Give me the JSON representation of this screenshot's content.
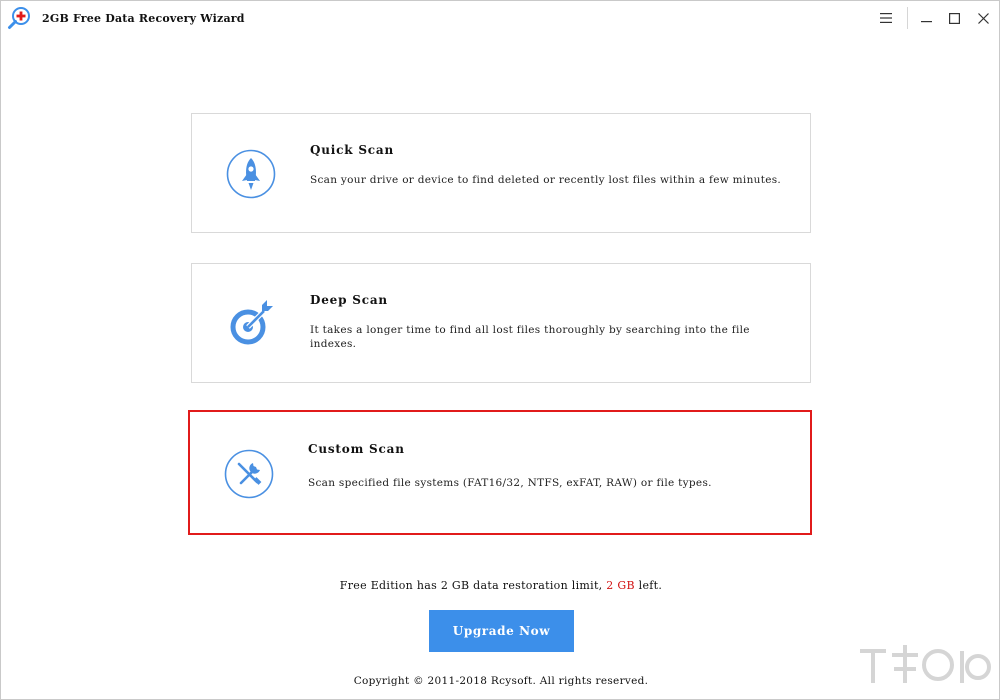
{
  "window": {
    "title": "2GB Free Data Recovery Wizard"
  },
  "titlebar_controls": [
    "menu-icon",
    "minimize-icon",
    "maximize-icon",
    "close-icon"
  ],
  "scan_options": [
    {
      "title": "Quick Scan",
      "description": "Scan your drive or device to find deleted or recently lost files within a few minutes.",
      "icon": "rocket-icon",
      "selected": false
    },
    {
      "title": "Deep Scan",
      "description": "It takes a longer time to find all lost files thoroughly by searching into the file indexes.",
      "icon": "target-icon",
      "selected": false
    },
    {
      "title": "Custom Scan",
      "description": "Scan specified file systems (FAT16/32, NTFS, exFAT, RAW) or file types.",
      "icon": "tools-icon",
      "selected": true
    }
  ],
  "limit_notice": {
    "prefix": "Free Edition has 2 GB data restoration limit, ",
    "remaining": "2 GB",
    "suffix": " left."
  },
  "upgrade_button": "Upgrade Now",
  "copyright": "Copyright © 2011-2018 Rcysoft. All rights reserved.",
  "colors": {
    "accent": "#3c8fea",
    "icon_blue": "#4a90e2",
    "selection_border": "#e11b1b",
    "limit_highlight": "#d21414"
  }
}
